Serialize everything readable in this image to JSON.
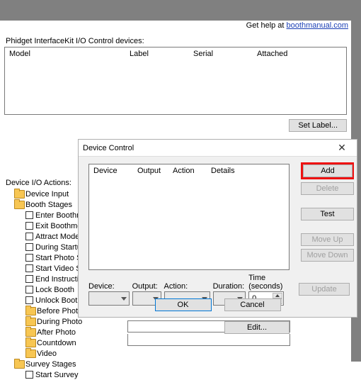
{
  "help": {
    "prefix": "Get help at ",
    "link": "boothmanual.com"
  },
  "devices": {
    "title": "Phidget InterfaceKit I/O Control devices:",
    "cols": {
      "model": "Model",
      "label": "Label",
      "serial": "Serial",
      "attached": "Attached"
    },
    "set_label": "Set Label..."
  },
  "actions": {
    "title": "Device I/O Actions:",
    "root1": "Device Input",
    "root2": "Booth Stages",
    "stage": {
      "enter": "Enter Boothmode",
      "exit": "Exit Boothmode",
      "attract": "Attract Mode",
      "startup": "During Startup",
      "startphoto": "Start Photo Session",
      "startvideo": "Start Video Session",
      "endinstr": "End Instructions",
      "lock": "Lock Booth",
      "unlock": "Unlock Booth",
      "before": "Before Photo",
      "during": "During Photo",
      "after": "After Photo",
      "countdown": "Countdown",
      "video": "Video"
    },
    "root3": "Survey Stages",
    "survey": {
      "start": "Start Survey"
    }
  },
  "edit_label": "Edit...",
  "dialog": {
    "title": "Device Control",
    "cols": {
      "device": "Device",
      "output": "Output",
      "action": "Action",
      "details": "Details"
    },
    "buttons": {
      "add": "Add",
      "delete": "Delete",
      "test": "Test",
      "moveup": "Move Up",
      "movedown": "Move Down",
      "update": "Update",
      "ok": "OK",
      "cancel": "Cancel"
    },
    "form": {
      "device": "Device:",
      "output": "Output:",
      "action": "Action:",
      "duration": "Duration:",
      "time": "Time (seconds)",
      "time_value": "0"
    }
  }
}
